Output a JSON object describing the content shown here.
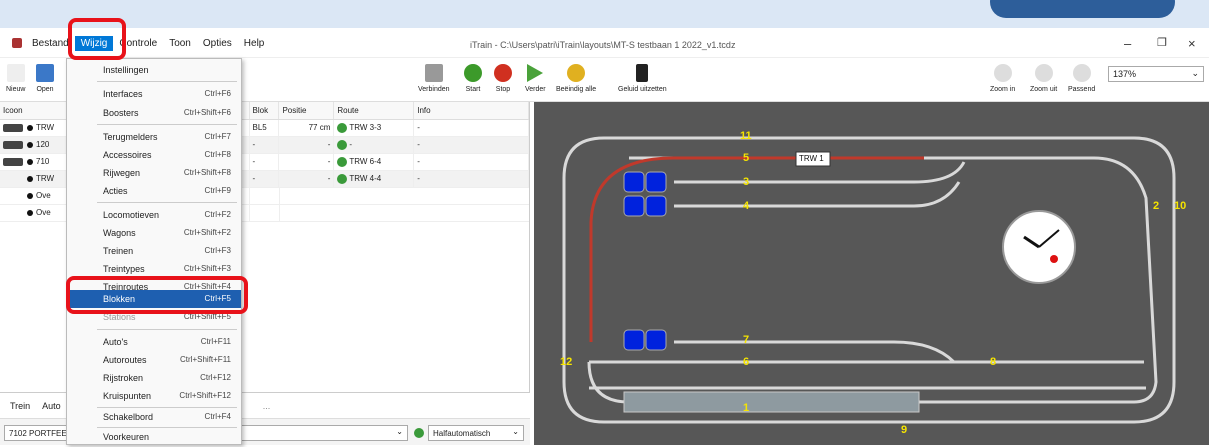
{
  "window": {
    "title": "iTrain - C:\\Users\\patri\\iTrain\\layouts\\MT-S testbaan 1 2022_v1.tcdz"
  },
  "menubar": [
    {
      "label": "Bestand"
    },
    {
      "label": "Wijzig",
      "active": true
    },
    {
      "label": "Controle"
    },
    {
      "label": "Toon"
    },
    {
      "label": "Opties"
    },
    {
      "label": "Help"
    }
  ],
  "toolbar_left": [
    "Nieuw",
    "Open"
  ],
  "toolbar_right": [
    "Verbinden",
    "Start",
    "Stop",
    "Verder",
    "Beëindig alle",
    "Geluid uitzetten"
  ],
  "zoom": {
    "buttons": [
      "Zoom in",
      "Zoom uit",
      "Passend"
    ],
    "level": "137%"
  },
  "table": {
    "headers": [
      "Icoon",
      "Blok",
      "Positie",
      "Route",
      "Info"
    ],
    "rows": [
      {
        "name": "TRW",
        "blok": "BL5",
        "positie": "77 cm",
        "route": "TRW 3-3",
        "info": "-"
      },
      {
        "name": "120",
        "blok": "-",
        "positie": "-",
        "route": "-",
        "info": "-"
      },
      {
        "name": "710",
        "blok": "-",
        "positie": "-",
        "route": "TRW 6-4",
        "info": "-"
      },
      {
        "name": "TRW",
        "blok": "-",
        "positie": "-",
        "route": "TRW 4-4",
        "info": "-"
      },
      {
        "name": "Ove",
        "blok": "",
        "positie": "",
        "route": "",
        "info": ""
      },
      {
        "name": "Ove",
        "blok": "",
        "positie": "",
        "route": "",
        "info": ""
      }
    ]
  },
  "bottom_tabs": [
    "Trein",
    "Auto"
  ],
  "bottom_controls": {
    "loco_select": "7102 PORTFEE",
    "ellipsis": "...",
    "mode": "Halfautomatisch"
  },
  "wijzig_menu": [
    {
      "label": "Instellingen",
      "shortcut": ""
    },
    {
      "label": "Interfaces",
      "shortcut": "Ctrl+F6"
    },
    {
      "label": "Boosters",
      "shortcut": "Ctrl+Shift+F6"
    },
    {
      "label": "Terugmelders",
      "shortcut": "Ctrl+F7"
    },
    {
      "label": "Accessoires",
      "shortcut": "Ctrl+F8"
    },
    {
      "label": "Rijwegen",
      "shortcut": "Ctrl+Shift+F8"
    },
    {
      "label": "Acties",
      "shortcut": "Ctrl+F9"
    },
    {
      "label": "Locomotieven",
      "shortcut": "Ctrl+F2"
    },
    {
      "label": "Wagons",
      "shortcut": "Ctrl+Shift+F2"
    },
    {
      "label": "Treinen",
      "shortcut": "Ctrl+F3"
    },
    {
      "label": "Treintypes",
      "shortcut": "Ctrl+Shift+F3"
    },
    {
      "label": "Treinroutes",
      "shortcut": "Ctrl+Shift+F4"
    },
    {
      "label": "Blokken",
      "shortcut": "Ctrl+F5",
      "selected": true
    },
    {
      "label": "Stations",
      "shortcut": "Ctrl+Shift+F5"
    },
    {
      "label": "Auto's",
      "shortcut": "Ctrl+F11"
    },
    {
      "label": "Autoroutes",
      "shortcut": "Ctrl+Shift+F11"
    },
    {
      "label": "Rijstroken",
      "shortcut": "Ctrl+F12"
    },
    {
      "label": "Kruispunten",
      "shortcut": "Ctrl+Shift+F12"
    },
    {
      "label": "Schakelbord",
      "shortcut": "Ctrl+F4"
    },
    {
      "label": "Voorkeuren",
      "shortcut": ""
    }
  ],
  "layout": {
    "track_labels": [
      "11",
      "5",
      "3",
      "4",
      "2",
      "10",
      "7",
      "6",
      "8",
      "12",
      "1",
      "9"
    ],
    "route_tag": "TRW 1"
  },
  "colors": {
    "accent": "#0078d7",
    "highlight": "#e8121a",
    "canvas": "#575757",
    "track": "#d9d9d9",
    "active_route": "#c0392b",
    "label": "#f5e400",
    "signal_block": "#0022dd"
  }
}
